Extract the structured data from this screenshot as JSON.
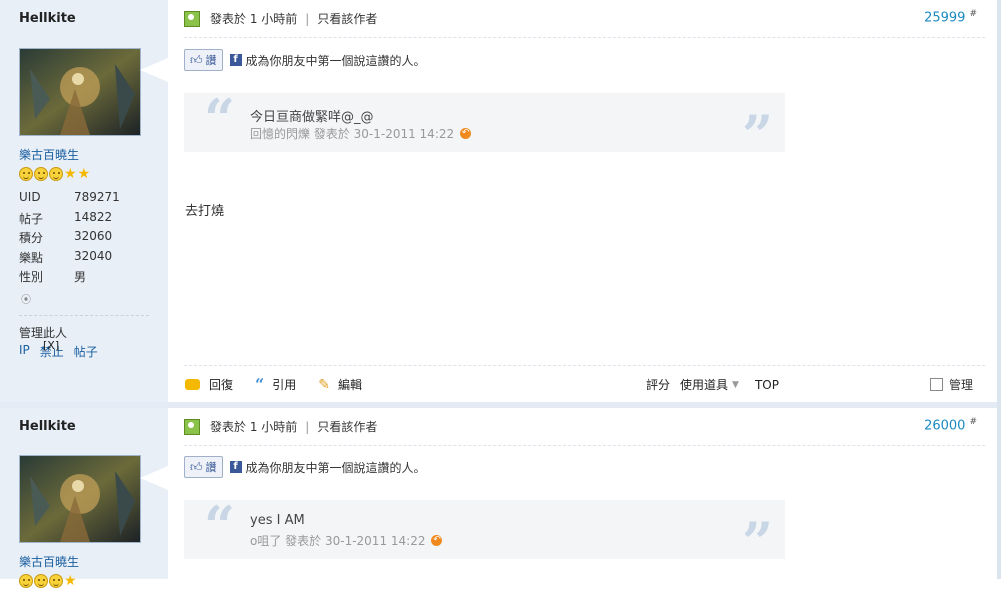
{
  "posts": [
    {
      "author": "Hellkite",
      "group": "樂古百曉生",
      "stats": [
        {
          "key": "UID",
          "value": "789271"
        },
        {
          "key": "帖子",
          "value": "14822"
        },
        {
          "key": "積分",
          "value": "32060"
        },
        {
          "key": "樂點",
          "value": "32040"
        },
        {
          "key": "性別",
          "value": "男"
        }
      ],
      "manage_label": "管理此人",
      "manage_links": [
        "IP",
        "禁止",
        "帖子"
      ],
      "posted": "發表於 1 小時前",
      "only_author": "只看該作者",
      "floor": "25999",
      "floor_mark": "#",
      "like_label": "讚",
      "fb_text": "成為你朋友中第一個說這讚的人。",
      "quote_text": "今日亘商做緊咩@_@",
      "quote_meta": "回憶的閃爍 發表於 30-1-2011 14:22",
      "message": "去打燒",
      "actions": {
        "reply": "回復",
        "quote": "引用",
        "edit": "編輯",
        "rate": "評分",
        "tools": "使用道具",
        "top": "TOP",
        "manage": "管理"
      }
    },
    {
      "author": "Hellkite",
      "group": "樂古百曉生",
      "posted": "發表於 1 小時前",
      "only_author": "只看該作者",
      "floor": "26000",
      "floor_mark": "#",
      "like_label": "讚",
      "fb_text": "成為你朋友中第一個說這讚的人。",
      "quote_text": "yes I AM",
      "quote_meta": "o咀了 發表於 30-1-2011 14:22"
    }
  ],
  "icons": {
    "online": "online-status-icon",
    "rss": "rss-icon",
    "close": "[X]"
  },
  "colors": {
    "sidebar": "#e8eff7",
    "link": "#1a5fa0",
    "floor": "#1a8ac0"
  }
}
